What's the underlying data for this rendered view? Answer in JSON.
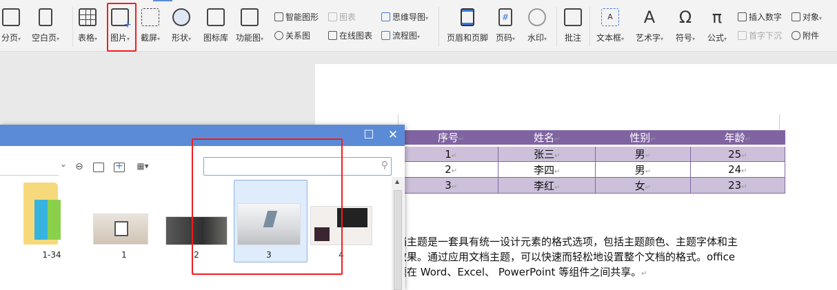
{
  "ribbon": {
    "big": [
      {
        "label": "分页",
        "dd": true
      },
      {
        "label": "空白页",
        "dd": true
      },
      {
        "label": "表格",
        "dd": true
      },
      {
        "label": "图片",
        "dd": true
      },
      {
        "label": "截屏",
        "dd": true
      },
      {
        "label": "形状",
        "dd": true
      },
      {
        "label": "图标库",
        "dd": false
      },
      {
        "label": "功能图",
        "dd": true
      },
      {
        "label": "页眉和页脚",
        "dd": false
      },
      {
        "label": "页码",
        "dd": true
      },
      {
        "label": "水印",
        "dd": true
      },
      {
        "label": "批注",
        "dd": false
      },
      {
        "label": "文本框",
        "dd": true
      },
      {
        "label": "艺术字",
        "dd": true
      },
      {
        "label": "符号",
        "dd": true
      },
      {
        "label": "公式",
        "dd": true
      }
    ],
    "small": {
      "smart_art": "智能图形",
      "chart": "图表",
      "relation": "关系图",
      "online_chart": "在线图表",
      "mindmap": "思维导图",
      "flowchart": "流程图",
      "insert_number": "插入数字",
      "drop_cap": "首字下沉",
      "object": "对象",
      "attachment": "附件"
    },
    "dd_arrow": "▾"
  },
  "document": {
    "table": {
      "headers": [
        "序号",
        "姓名",
        "性别",
        "年龄"
      ],
      "rows": [
        [
          "1",
          "张三",
          "男",
          "25"
        ],
        [
          "2",
          "李四",
          "男",
          "24"
        ],
        [
          "3",
          "李红",
          "女",
          "23"
        ]
      ]
    },
    "paragraph": [
      "文档主题是一套具有统一设计元素的格式选项，包括主题颜色、主题字体和主",
      "题效果。通过应用文档主题，可以快速而轻松地设置整个文档的格式。office",
      "主题在 Word、Excel、 PowerPoint 等组件之间共享。"
    ],
    "para_mark": "↵"
  },
  "dialog": {
    "maximize": "☐",
    "close": "✕",
    "search_placeholder": "",
    "files": [
      {
        "name": "1-34",
        "type": "folder"
      },
      {
        "name": "1",
        "type": "image"
      },
      {
        "name": "2",
        "type": "image"
      },
      {
        "name": "3",
        "type": "image",
        "selected": true
      },
      {
        "name": "4",
        "type": "image"
      }
    ]
  },
  "colors": {
    "accent": "#5b8bd6",
    "table_header": "#8064a2",
    "table_band": "#ccc0da",
    "highlight": "#f21d1d"
  }
}
